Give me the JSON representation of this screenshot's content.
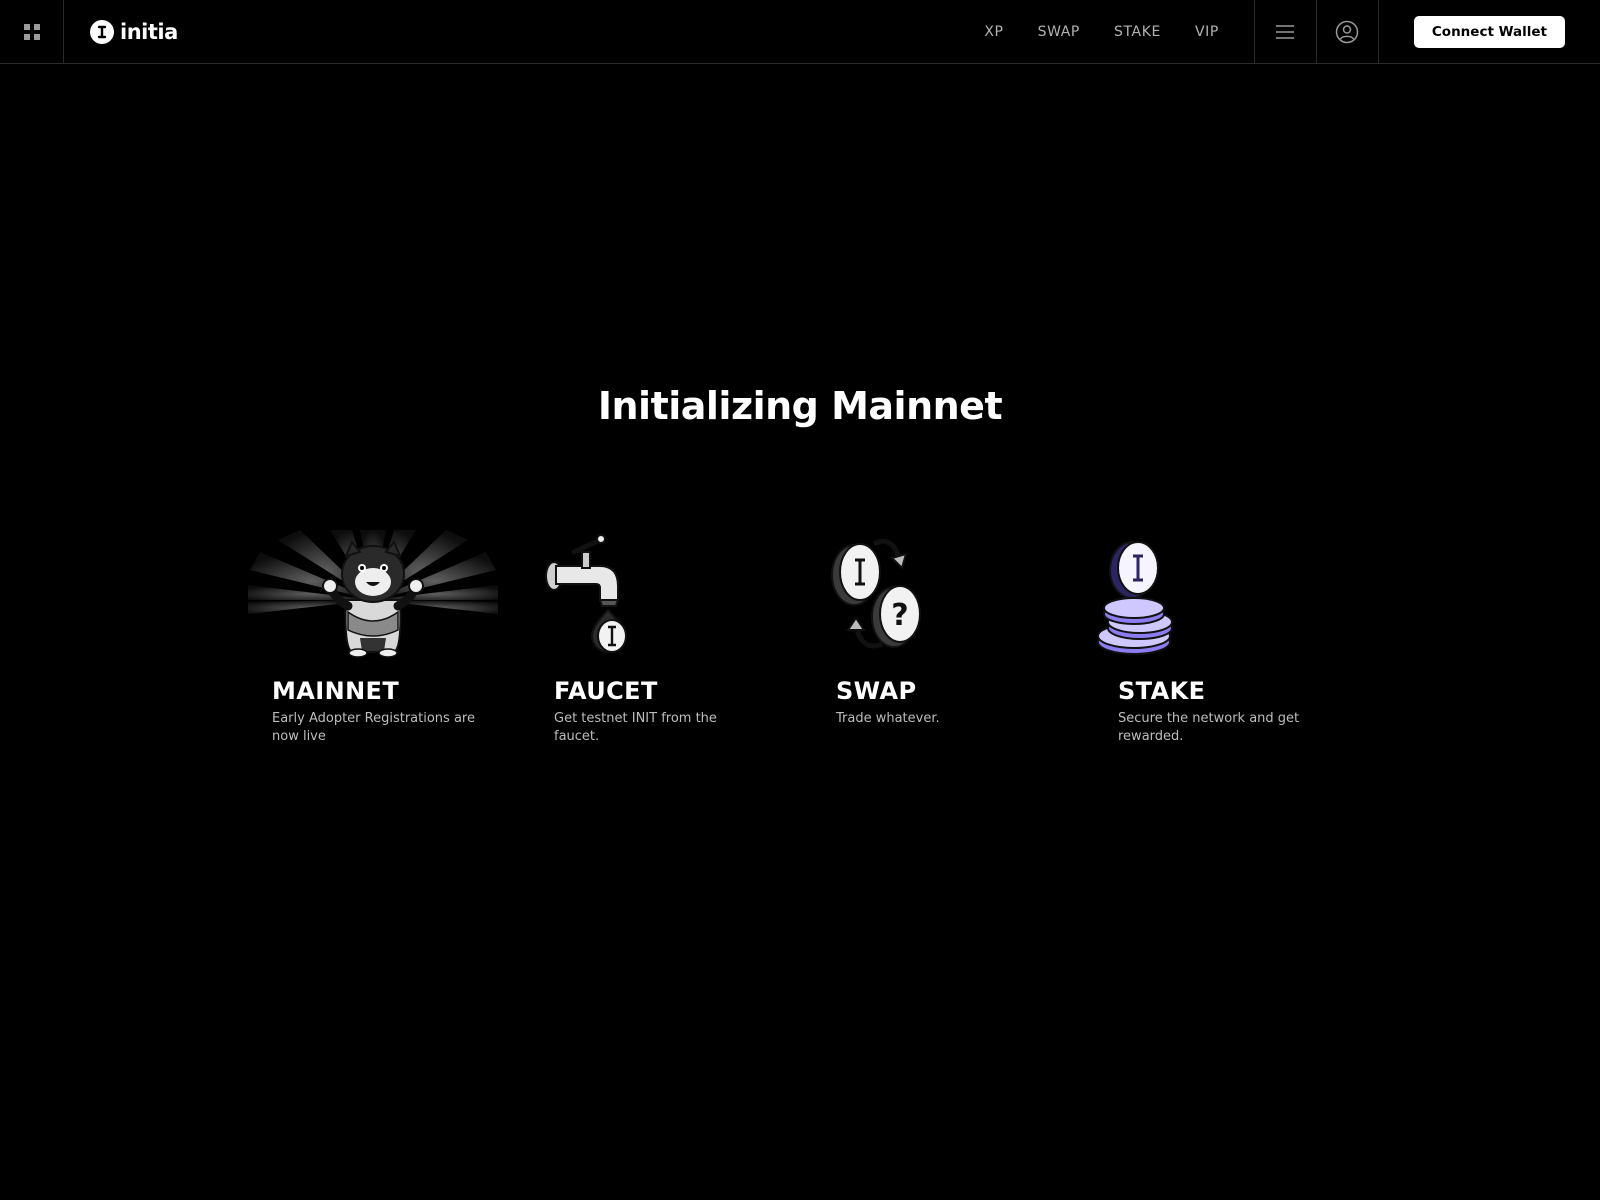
{
  "brand": {
    "name": "initia",
    "logo_icon": "initia-logo-icon"
  },
  "nav": {
    "items": [
      "XP",
      "SWAP",
      "STAKE",
      "VIP"
    ]
  },
  "header": {
    "connect_wallet_label": "Connect Wallet",
    "apps_icon": "apps-grid-icon",
    "menu_icon": "hamburger-menu-icon",
    "account_icon": "user-circle-icon"
  },
  "hero": {
    "title": "Initializing Mainnet"
  },
  "cards": [
    {
      "title": "MAINNET",
      "description": "Early Adopter Registrations are now live",
      "icon": "mascot-bear-icon"
    },
    {
      "title": "FAUCET",
      "description": "Get testnet INIT from the faucet.",
      "icon": "faucet-tap-icon"
    },
    {
      "title": "SWAP",
      "description": "Trade whatever.",
      "icon": "swap-coins-icon"
    },
    {
      "title": "STAKE",
      "description": "Secure the network and get rewarded.",
      "icon": "stacked-coins-icon"
    }
  ],
  "colors": {
    "background": "#000000",
    "text": "#ffffff",
    "muted": "#bdbdbd",
    "stake_accent": "#8b7cf0"
  }
}
